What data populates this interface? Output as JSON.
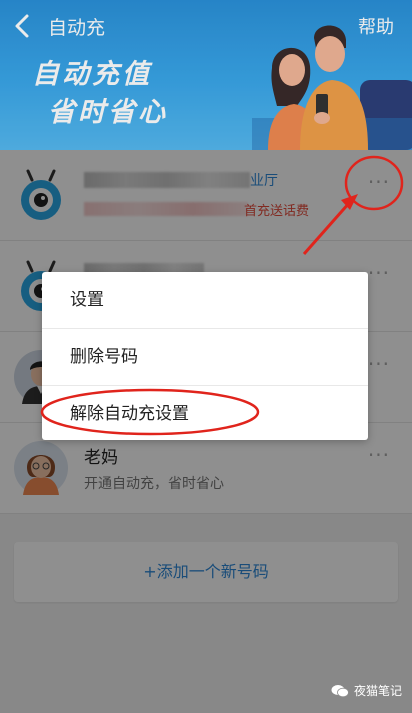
{
  "header": {
    "title": "自动充",
    "help_label": "帮助",
    "slogan_line1": "自动充值",
    "slogan_line2": "省时省心"
  },
  "numbers": [
    {
      "name_suffix": "业厅",
      "sub_suffix": "首充送话费",
      "more_glyph": "···"
    },
    {
      "more_glyph": "···"
    },
    {
      "more_glyph": "···"
    },
    {
      "name": "老妈",
      "sub": "开通自动充，省时省心",
      "more_glyph": "···"
    }
  ],
  "add_number_label": "+添加一个新号码",
  "menu": {
    "items": [
      {
        "label": "设置"
      },
      {
        "label": "删除号码"
      },
      {
        "label": "解除自动充设置"
      }
    ]
  },
  "watermark": "夜猫笔记",
  "colors": {
    "brand_blue": "#2e88d8",
    "annotation_red": "#e0241c"
  }
}
